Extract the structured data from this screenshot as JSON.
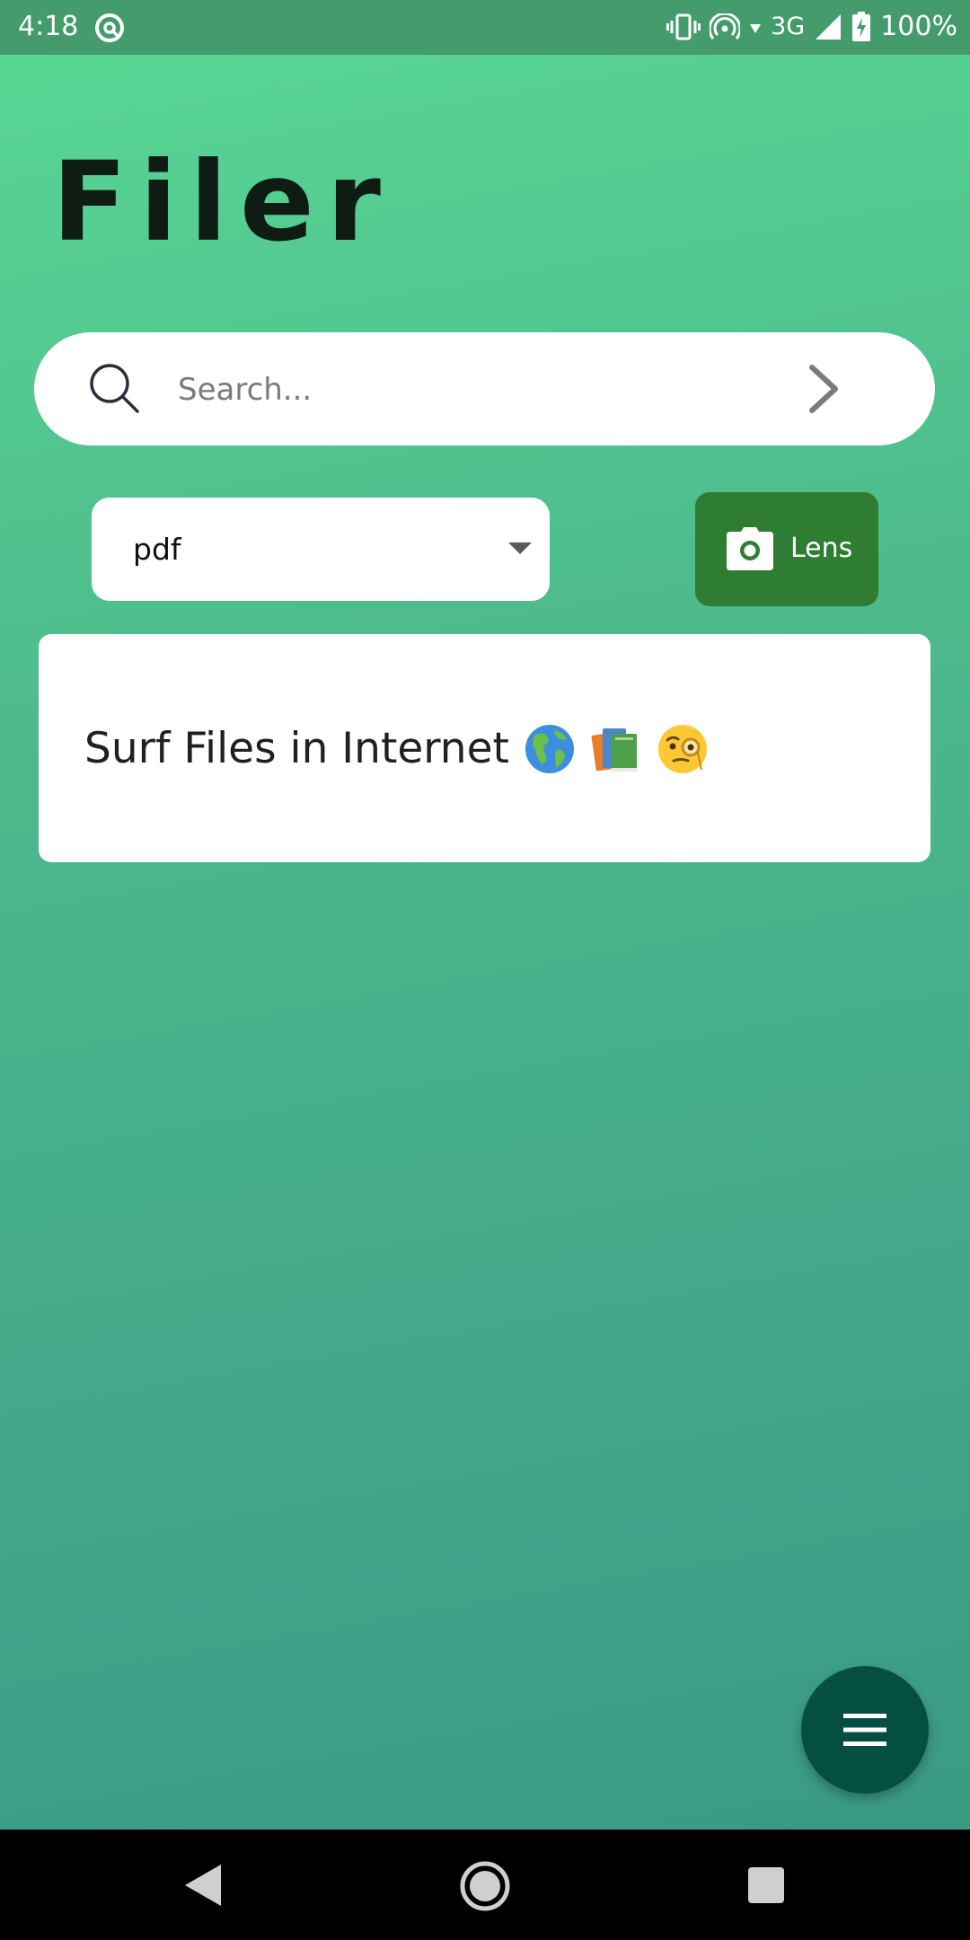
{
  "status_bar": {
    "time": "4:18",
    "network": "3G",
    "battery": "100%",
    "icons": [
      "app-notification-icon",
      "vibrate-icon",
      "hotspot-icon",
      "wifi-down-arrow-icon",
      "cell-signal-icon",
      "battery-charging-icon"
    ]
  },
  "app": {
    "title": "Filer"
  },
  "search": {
    "placeholder": "Search...",
    "value": ""
  },
  "file_type": {
    "selected": "pdf"
  },
  "lens": {
    "label": "Lens"
  },
  "card": {
    "text": "Surf Files in Internet",
    "emojis": [
      "globe-americas",
      "books",
      "face-with-monocle"
    ]
  },
  "colors": {
    "status_bar": "#449c6d",
    "gradient_top": "#59d894",
    "gradient_bottom": "#399783",
    "lens_button": "#2e7d32",
    "fab": "#054f42",
    "title": "#0e1c14"
  }
}
